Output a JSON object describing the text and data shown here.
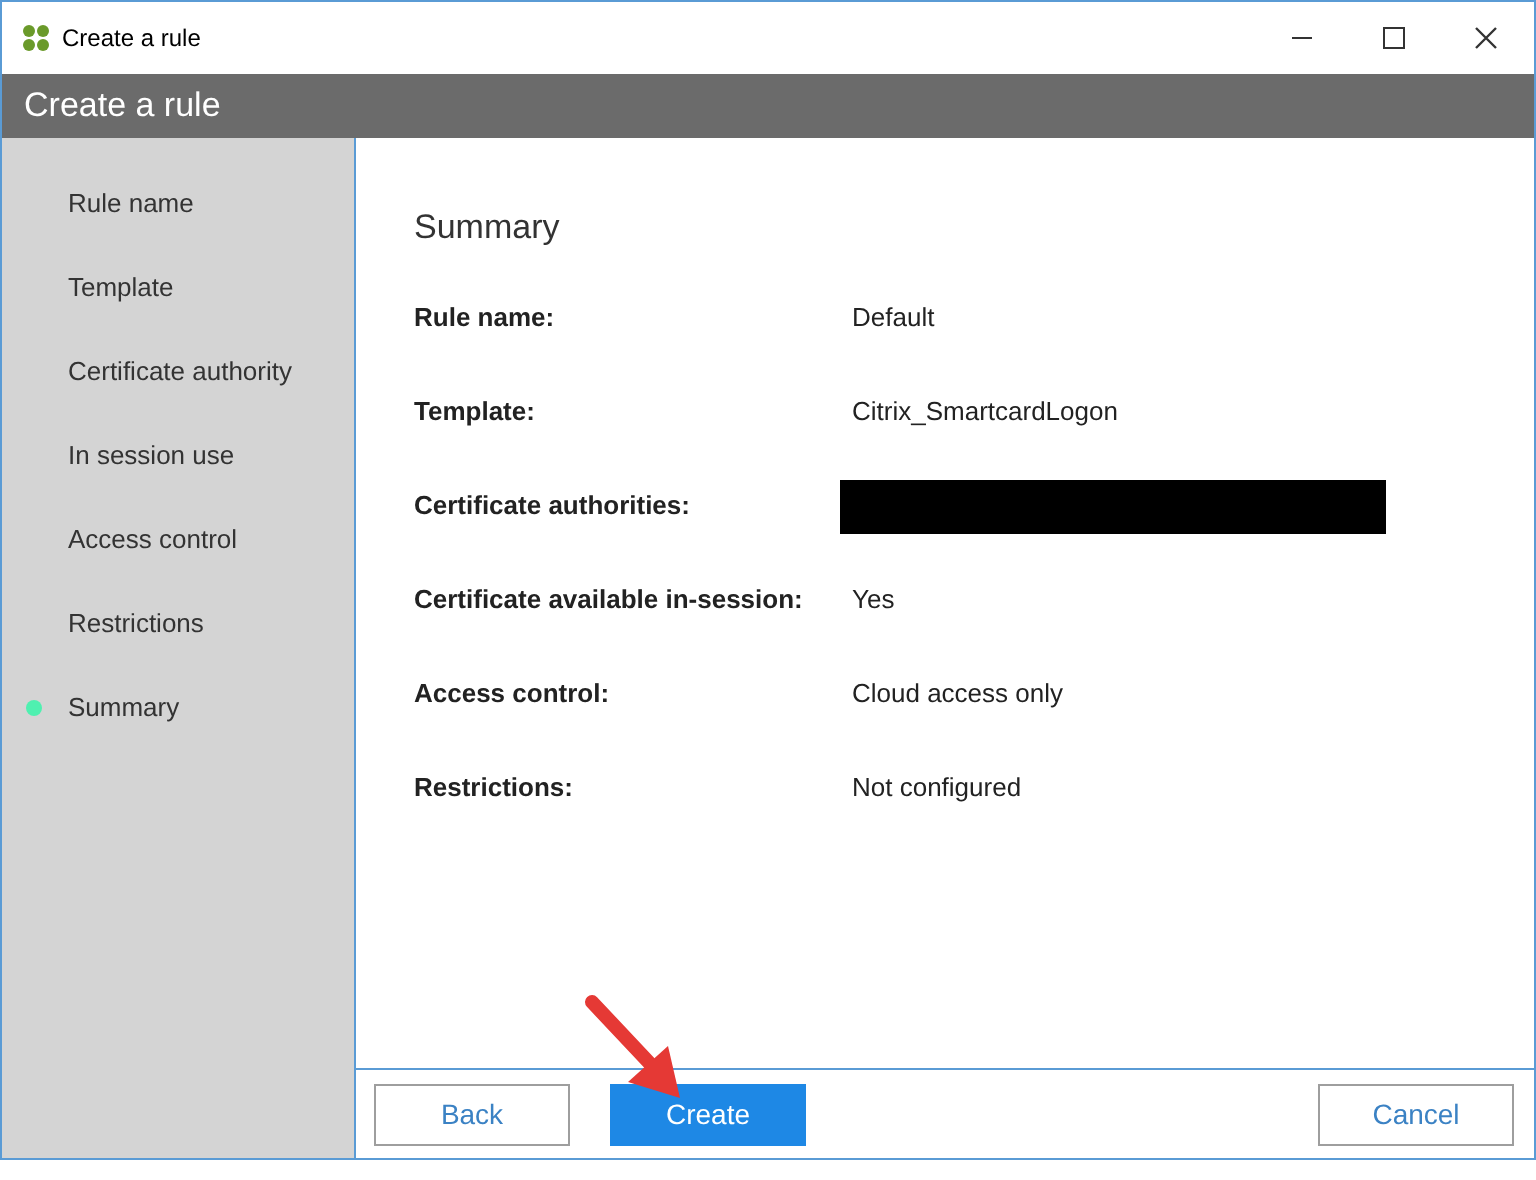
{
  "window": {
    "title": "Create a rule"
  },
  "header": {
    "title": "Create a rule"
  },
  "steps": [
    {
      "label": "Rule name",
      "selected": false
    },
    {
      "label": "Template",
      "selected": false
    },
    {
      "label": "Certificate authority",
      "selected": false
    },
    {
      "label": "In session use",
      "selected": false
    },
    {
      "label": "Access control",
      "selected": false
    },
    {
      "label": "Restrictions",
      "selected": false
    },
    {
      "label": "Summary",
      "selected": true
    }
  ],
  "summary": {
    "title": "Summary",
    "rows": [
      {
        "kind": "text",
        "label": "Rule name:",
        "value": "Default"
      },
      {
        "kind": "text",
        "label": "Template:",
        "value": "Citrix_SmartcardLogon"
      },
      {
        "kind": "redacted",
        "label": "Certificate authorities:"
      },
      {
        "kind": "text",
        "label": "Certificate available in-session:",
        "value": "Yes"
      },
      {
        "kind": "text",
        "label": "Access control:",
        "value": "Cloud access only"
      },
      {
        "kind": "text",
        "label": "Restrictions:",
        "value": "Not configured"
      }
    ]
  },
  "buttons": [
    {
      "label": "Back",
      "kind": "secondary"
    },
    {
      "label": "Create",
      "kind": "primary"
    },
    {
      "label": "Cancel",
      "kind": "secondary"
    }
  ]
}
